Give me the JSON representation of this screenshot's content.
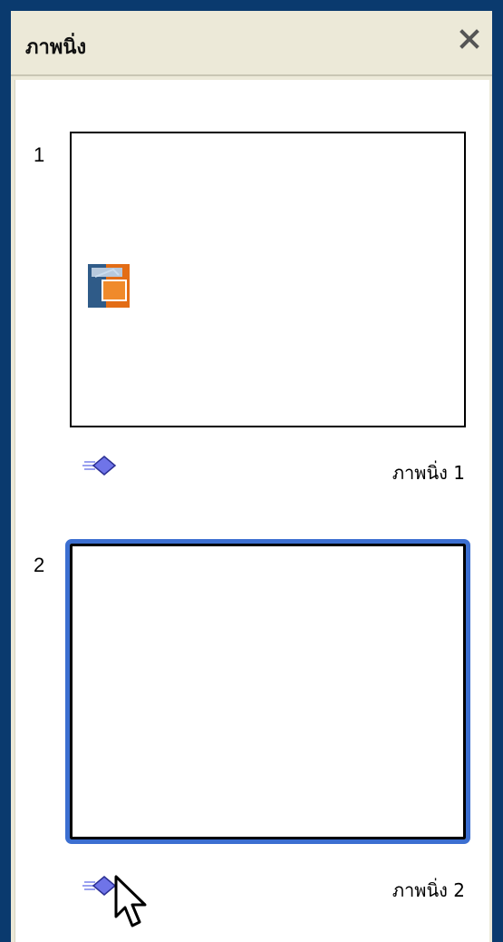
{
  "panel": {
    "title": "ภาพนิ่ง",
    "close_icon": "close-icon"
  },
  "slides": [
    {
      "number": "1",
      "name": "ภาพนิ่ง 1",
      "selected": false,
      "has_image": true
    },
    {
      "number": "2",
      "name": "ภาพนิ่ง 2",
      "selected": true,
      "has_image": false
    }
  ],
  "colors": {
    "frame": "#0a3a6e",
    "panel_bg": "#ece9d8",
    "content_bg": "#ffffff",
    "selection": "#3c6fd1",
    "transition_diamond": "#6f74e8"
  }
}
